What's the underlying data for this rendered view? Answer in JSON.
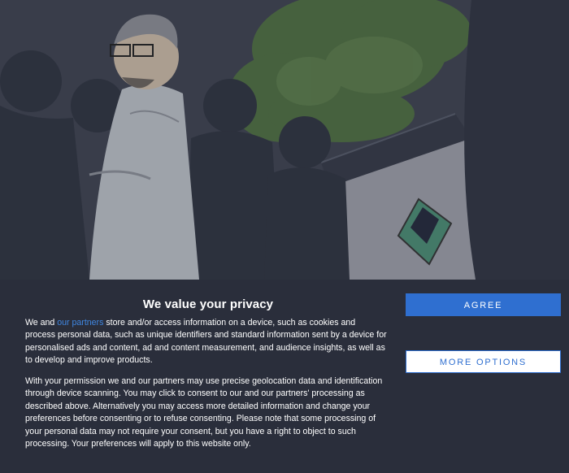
{
  "background": {
    "description_colors": {
      "sky": "#3b3f4d",
      "foliage": "#4c6a3e",
      "shadow": "#3a3e4b"
    }
  },
  "consent": {
    "title": "We value your privacy",
    "paragraph1_before_link": "We and ",
    "paragraph1_link": "our partners",
    "paragraph1_after_link": " store and/or access information on a device, such as cookies and process personal data, such as unique identifiers and standard information sent by a device for personalised ads and content, ad and content measurement, and audience insights, as well as to develop and improve products.",
    "paragraph2": "With your permission we and our partners may use precise geolocation data and identification through device scanning. You may click to consent to our and our partners' processing as described above. Alternatively you may access more detailed information and change your preferences before consenting or to refuse consenting. Please note that some processing of your personal data may not require your consent, but you have a right to object to such processing. Your preferences will apply to this website only.",
    "agree_label": "AGREE",
    "more_options_label": "MORE OPTIONS"
  },
  "colors": {
    "panel_bg": "#2a2e3b",
    "accent": "#2f6fd0",
    "link": "#3f86e0"
  }
}
